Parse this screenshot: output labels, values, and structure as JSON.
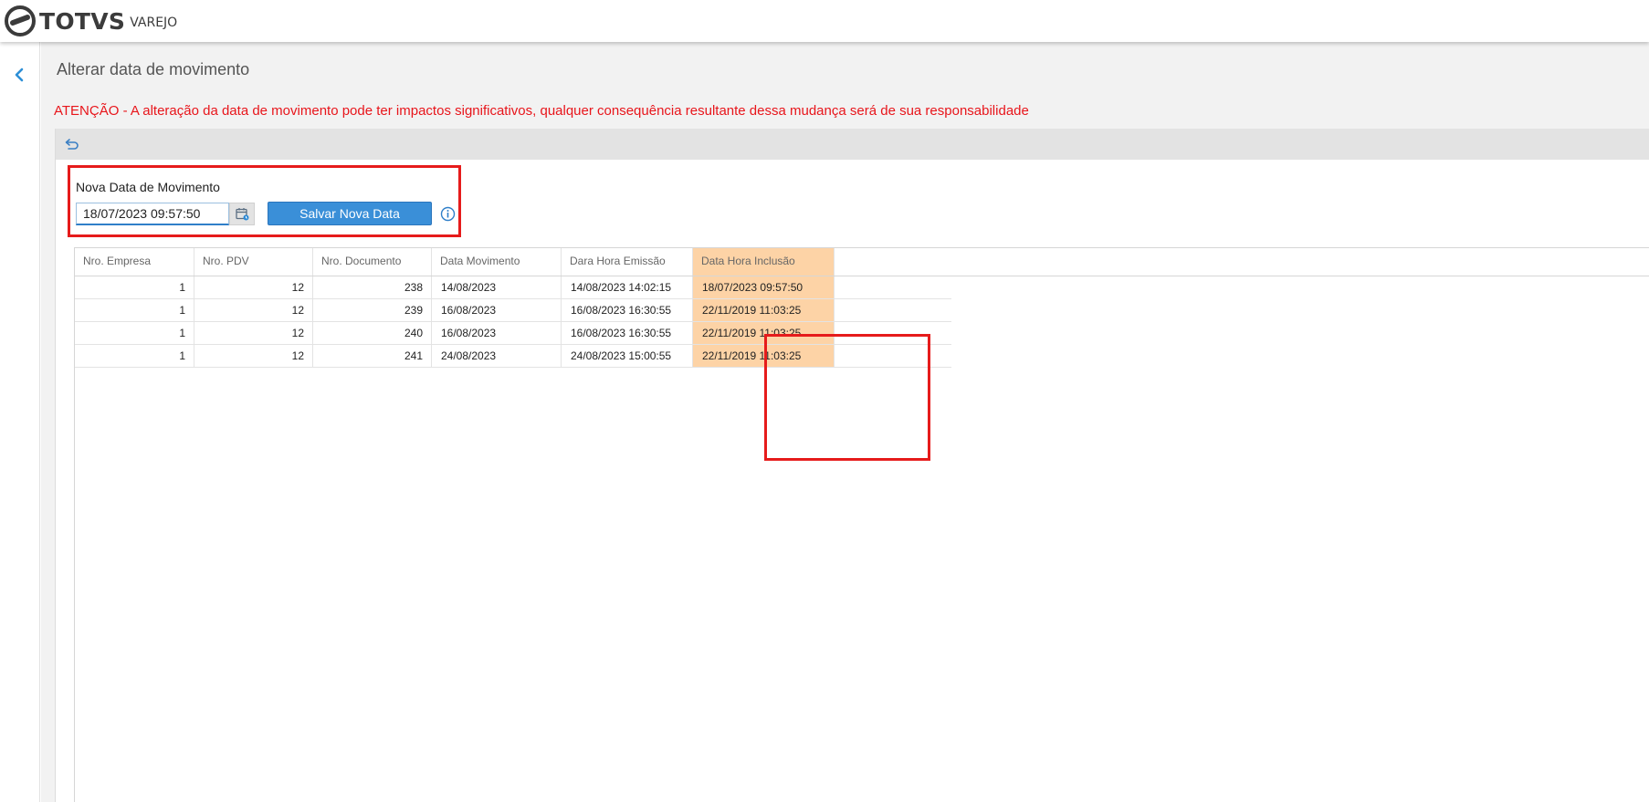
{
  "brand": {
    "name": "TOTVS",
    "product": "VAREJO"
  },
  "page": {
    "title": "Alterar data de movimento",
    "warning": "ATENÇÃO - A alteração da data de movimento pode ter impactos significativos, qualquer consequência resultante dessa mudança será de sua responsabilidade"
  },
  "icons": {
    "back": "chevron-left-icon",
    "undo": "undo-icon",
    "calendar": "calendar-icon",
    "info": "info-icon"
  },
  "form": {
    "label": "Nova Data de Movimento",
    "date_value": "18/07/2023 09:57:50",
    "save_label": "Salvar Nova Data"
  },
  "grid": {
    "columns": [
      "Nro. Empresa",
      "Nro. PDV",
      "Nro. Documento",
      "Data Movimento",
      "Dara Hora Emissão",
      "Data Hora Inclusão"
    ],
    "rows": [
      [
        "1",
        "12",
        "238",
        "14/08/2023",
        "14/08/2023 14:02:15",
        "18/07/2023 09:57:50"
      ],
      [
        "1",
        "12",
        "239",
        "16/08/2023",
        "16/08/2023 16:30:55",
        "22/11/2019 11:03:25"
      ],
      [
        "1",
        "12",
        "240",
        "16/08/2023",
        "16/08/2023 16:30:55",
        "22/11/2019 11:03:25"
      ],
      [
        "1",
        "12",
        "241",
        "24/08/2023",
        "24/08/2023 15:00:55",
        "22/11/2019 11:03:25"
      ]
    ]
  },
  "colors": {
    "accent": "#3a8fd8",
    "warning": "#e8151b",
    "highlight": "#fdd3a6",
    "outline": "#e61b1b"
  }
}
